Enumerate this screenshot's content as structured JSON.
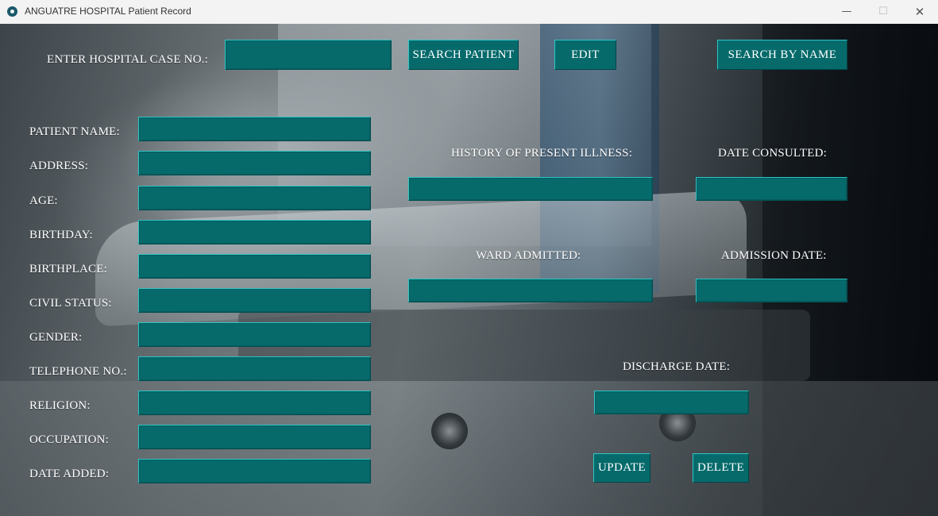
{
  "window": {
    "title": "ANGUATRE HOSPITAL Patient Record",
    "minimize_glyph": "—",
    "maximize_glyph": "☐",
    "close_glyph": "✕"
  },
  "search": {
    "case_label": "ENTER HOSPITAL CASE NO.:",
    "case_value": "",
    "search_patient_label": "SEARCH PATIENT",
    "edit_label": "EDIT",
    "search_by_name_label": "SEARCH BY NAME"
  },
  "patient_fields": {
    "patient_name": {
      "label": "PATIENT NAME:",
      "value": ""
    },
    "address": {
      "label": "ADDRESS:",
      "value": ""
    },
    "age": {
      "label": "AGE:",
      "value": ""
    },
    "birthday": {
      "label": "BIRTHDAY:",
      "value": ""
    },
    "birthplace": {
      "label": "BIRTHPLACE:",
      "value": ""
    },
    "civil_status": {
      "label": "CIVIL STATUS:",
      "value": ""
    },
    "gender": {
      "label": "GENDER:",
      "value": ""
    },
    "telephone": {
      "label": "TELEPHONE NO.:",
      "value": ""
    },
    "religion": {
      "label": "RELIGION:",
      "value": ""
    },
    "occupation": {
      "label": "OCCUPATION:",
      "value": ""
    },
    "date_added": {
      "label": "DATE ADDED:",
      "value": ""
    }
  },
  "admission": {
    "history_label": "HISTORY OF PRESENT ILLNESS:",
    "history_value": "",
    "date_consulted_label": "DATE CONSULTED:",
    "date_consulted_value": "",
    "ward_label": "WARD ADMITTED:",
    "ward_value": "",
    "admission_date_label": "ADMISSION DATE:",
    "admission_date_value": "",
    "discharge_date_label": "DISCHARGE DATE:",
    "discharge_date_value": ""
  },
  "actions": {
    "update_label": "UPDATE",
    "delete_label": "DELETE"
  }
}
